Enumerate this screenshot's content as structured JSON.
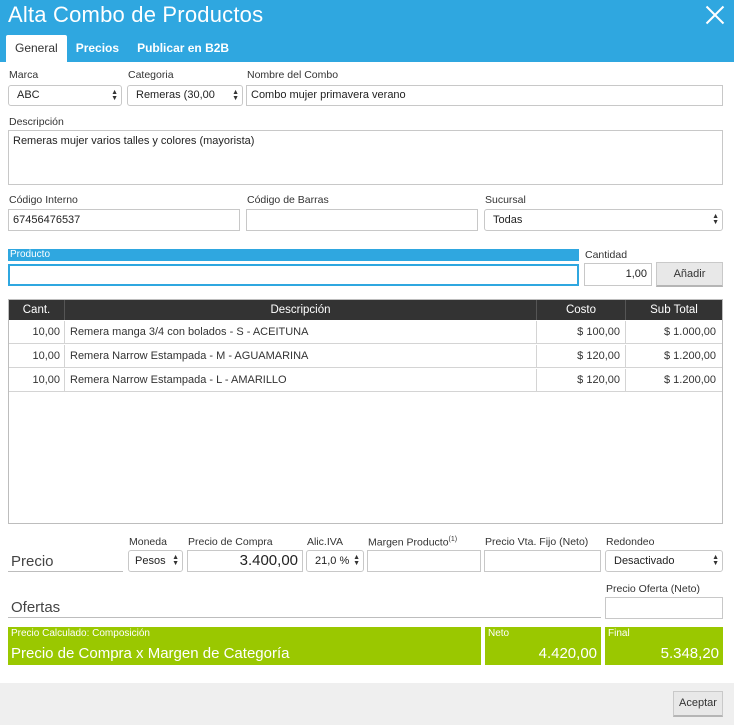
{
  "window": {
    "title": "Alta Combo de Productos",
    "close_icon": "close-icon"
  },
  "tabs": [
    {
      "label": "General",
      "active": true
    },
    {
      "label": "Precios",
      "active": false
    },
    {
      "label": "Publicar en B2B",
      "active": false
    }
  ],
  "form": {
    "marca": {
      "label": "Marca",
      "value": "ABC"
    },
    "categoria": {
      "label": "Categoria",
      "value": "Remeras (30,00"
    },
    "nombre": {
      "label": "Nombre del Combo",
      "value": "Combo mujer primavera verano"
    },
    "descripcion": {
      "label": "Descripción",
      "value": "Remeras mujer varios talles y colores (mayorista)"
    },
    "codigo_interno": {
      "label": "Código Interno",
      "value": "67456476537"
    },
    "codigo_barras": {
      "label": "Código de Barras",
      "value": ""
    },
    "sucursal": {
      "label": "Sucursal",
      "value": "Todas"
    },
    "producto": {
      "label": "Producto",
      "value": ""
    },
    "cantidad": {
      "label": "Cantidad",
      "value": "1,00"
    },
    "anadir_label": "Añadir"
  },
  "table": {
    "headers": [
      "Cant.",
      "Descripción",
      "Costo",
      "Sub Total"
    ],
    "rows": [
      {
        "cant": "10,00",
        "desc": "Remera manga 3/4 con bolados - S - ACEITUNA",
        "costo": "$ 100,00",
        "subtotal": "$ 1.000,00"
      },
      {
        "cant": "10,00",
        "desc": "Remera Narrow Estampada - M - AGUAMARINA",
        "costo": "$ 120,00",
        "subtotal": "$ 1.200,00"
      },
      {
        "cant": "10,00",
        "desc": "Remera Narrow Estampada - L - AMARILLO",
        "costo": "$ 120,00",
        "subtotal": "$ 1.200,00"
      }
    ]
  },
  "precio": {
    "section_label": "Precio",
    "moneda": {
      "label": "Moneda",
      "value": "Pesos"
    },
    "precio_compra": {
      "label": "Precio de Compra",
      "value": "3.400,00"
    },
    "alic_iva": {
      "label": "Alic.IVA",
      "value": "21,0 %"
    },
    "margen": {
      "label": "Margen Producto",
      "sup": "(1)",
      "value": ""
    },
    "precio_vta_fijo": {
      "label": "Precio Vta. Fijo (Neto)",
      "value": ""
    },
    "redondeo": {
      "label": "Redondeo",
      "value": "Desactivado"
    }
  },
  "ofertas": {
    "section_label": "Ofertas",
    "precio_oferta": {
      "label": "Precio Oferta (Neto)",
      "value": ""
    }
  },
  "calculado": {
    "small_label": "Precio Calculado: Composición",
    "formula": "Precio de Compra x Margen de Categoría",
    "neto_label": "Neto",
    "neto_value": "4.420,00",
    "final_label": "Final",
    "final_value": "5.348,20"
  },
  "footer": {
    "aceptar_label": "Aceptar"
  },
  "colors": {
    "accent": "#2fa7e0",
    "green": "#9ac800",
    "table_header": "#333333"
  }
}
